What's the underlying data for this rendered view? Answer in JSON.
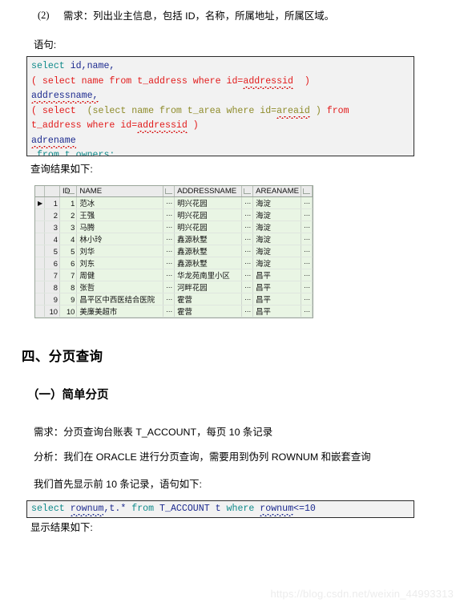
{
  "colors": {
    "code_keyword_teal": "#0f8a8a",
    "code_identifier_blue": "#1c2a8f",
    "code_red": "#e21b1b",
    "code_olive": "#8e8b2a",
    "code_bg": "#f2f2f2",
    "code_border": "#2b2b2b",
    "grid_row_green": "#e9f5e4",
    "grid_header_gray": "#ebebeb",
    "watermark": "#ececec"
  },
  "requirement_item": {
    "number": "(2)",
    "text": "需求：列出业主信息，包括 ID，名称，所属地址，所属区域。"
  },
  "labels": {
    "statement": "语句:",
    "query_result": "查询结果如下:",
    "display_result": "显示结果如下:"
  },
  "code_block_1": {
    "lines": [
      [
        {
          "t": "select ",
          "c": "kw"
        },
        {
          "t": "id,name,",
          "c": "idb"
        }
      ],
      [
        {
          "t": "( select name from t_address where id=",
          "c": "rd"
        },
        {
          "t": "addressid",
          "c": "rd",
          "sq": true
        },
        {
          "t": "  )",
          "c": "rd"
        }
      ],
      [
        {
          "t": "addressname,",
          "c": "idb",
          "sq": true
        }
      ],
      [
        {
          "t": "( select  ",
          "c": "rd"
        },
        {
          "t": "(select name from t_area where id=",
          "c": "ol"
        },
        {
          "t": "areaid",
          "c": "ol",
          "sq": true
        },
        {
          "t": " ) ",
          "c": "ol"
        },
        {
          "t": "from",
          "c": "rd"
        }
      ],
      [
        {
          "t": "t_address where id=",
          "c": "rd"
        },
        {
          "t": "addressid",
          "c": "rd",
          "sq": true
        },
        {
          "t": " )",
          "c": "rd"
        }
      ],
      [
        {
          "t": "adrename",
          "c": "idb",
          "sq": true
        }
      ],
      [
        {
          "t": " from t_owners;",
          "c": "kw"
        }
      ]
    ]
  },
  "result_grid": {
    "headers": [
      "",
      "",
      "ID",
      "NAME",
      "",
      "ADDRESSNAME",
      "",
      "AREANAME",
      ""
    ],
    "columns": [
      "ID",
      "NAME",
      "ADDRESSNAME",
      "AREANAME"
    ],
    "rows": [
      {
        "rowno": "1",
        "selected": true,
        "id": "1",
        "name": "范冰",
        "addressname": "明兴花园",
        "areaname": "海淀"
      },
      {
        "rowno": "2",
        "selected": false,
        "id": "2",
        "name": "王强",
        "addressname": "明兴花园",
        "areaname": "海淀"
      },
      {
        "rowno": "3",
        "selected": false,
        "id": "3",
        "name": "马腾",
        "addressname": "明兴花园",
        "areaname": "海淀"
      },
      {
        "rowno": "4",
        "selected": false,
        "id": "4",
        "name": "林小玲",
        "addressname": "鑫源秋墅",
        "areaname": "海淀"
      },
      {
        "rowno": "5",
        "selected": false,
        "id": "5",
        "name": "刘华",
        "addressname": "鑫源秋墅",
        "areaname": "海淀"
      },
      {
        "rowno": "6",
        "selected": false,
        "id": "6",
        "name": "刘东",
        "addressname": "鑫源秋墅",
        "areaname": "海淀"
      },
      {
        "rowno": "7",
        "selected": false,
        "id": "7",
        "name": "周健",
        "addressname": "华龙苑南里小区",
        "areaname": "昌平"
      },
      {
        "rowno": "8",
        "selected": false,
        "id": "8",
        "name": "张哲",
        "addressname": "河畔花园",
        "areaname": "昌平"
      },
      {
        "rowno": "9",
        "selected": false,
        "id": "9",
        "name": "昌平区中西医结合医院",
        "addressname": "霍营",
        "areaname": "昌平"
      },
      {
        "rowno": "10",
        "selected": false,
        "id": "10",
        "name": "美廉美超市",
        "addressname": "霍营",
        "areaname": "昌平"
      }
    ],
    "cell_overflow_glyph": "⋯"
  },
  "section": {
    "heading": "四、分页查询",
    "subheading": "（一）简单分页",
    "requirement": "需求：分页查询台账表 T_ACCOUNT，每页 10 条记录",
    "analysis": "分析：我们在 ORACLE 进行分页查询，需要用到伪列 ROWNUM 和嵌套查询",
    "lead_in": "我们首先显示前 10 条记录，语句如下:"
  },
  "code_block_2": {
    "lines": [
      [
        {
          "t": "select ",
          "c": "kw"
        },
        {
          "t": "rownum",
          "c": "idb",
          "sqb": true
        },
        {
          "t": ",t.* ",
          "c": "idb"
        },
        {
          "t": "from ",
          "c": "kw"
        },
        {
          "t": "T_ACCOUNT t ",
          "c": "idb"
        },
        {
          "t": "where ",
          "c": "kw"
        },
        {
          "t": "rownum",
          "c": "idb",
          "sqb": true
        },
        {
          "t": "<=10",
          "c": "idb"
        }
      ]
    ]
  },
  "watermark": "https://blog.csdn.net/weixin_44993313"
}
